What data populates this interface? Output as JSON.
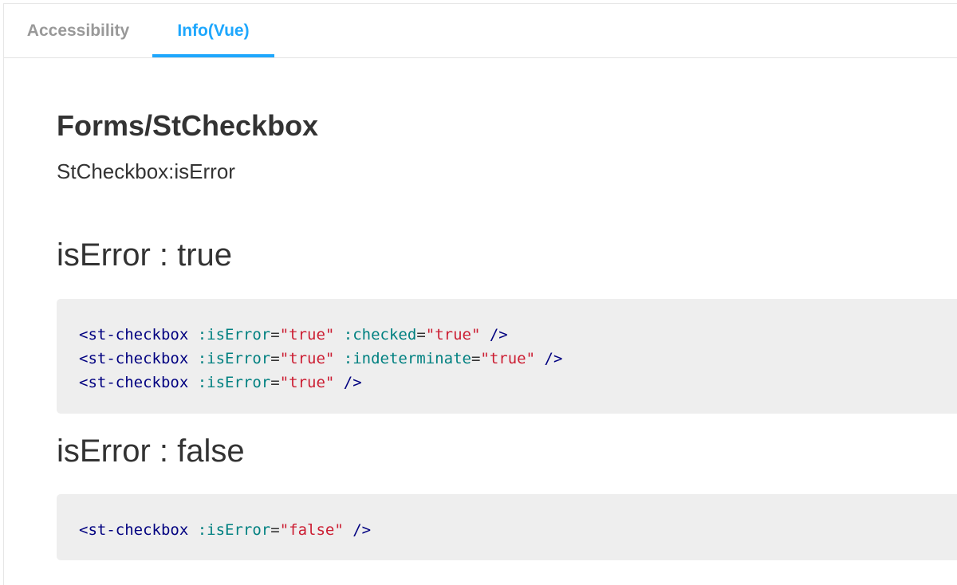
{
  "tabs": [
    {
      "label": "Accessibility",
      "active": false
    },
    {
      "label": "Info(Vue)",
      "active": true
    }
  ],
  "colors": {
    "active_tab": "#1ea7fd",
    "inactive_tab": "#999999",
    "code_background": "#eeeeee",
    "code_tag": "#000080",
    "code_attr": "#008080",
    "code_string": "#cc1e33"
  },
  "page": {
    "title": "Forms/StCheckbox",
    "subtitle": "StCheckbox:isError"
  },
  "sections": [
    {
      "heading": "isError : true",
      "code_lines": [
        {
          "tag": "<st-checkbox",
          "attr1": ":isError",
          "eq1": "=",
          "val1": "\"true\"",
          "attr2": ":checked",
          "eq2": "=",
          "val2": "\"true\"",
          "close": "/>"
        },
        {
          "tag": "<st-checkbox",
          "attr1": ":isError",
          "eq1": "=",
          "val1": "\"true\"",
          "attr2": ":indeterminate",
          "eq2": "=",
          "val2": "\"true\"",
          "close": "/>"
        },
        {
          "tag": "<st-checkbox",
          "attr1": ":isError",
          "eq1": "=",
          "val1": "\"true\"",
          "close": "/>"
        }
      ]
    },
    {
      "heading": "isError : false",
      "code_lines": [
        {
          "tag": "<st-checkbox",
          "attr1": ":isError",
          "eq1": "=",
          "val1": "\"false\"",
          "close": "/>"
        }
      ]
    }
  ]
}
